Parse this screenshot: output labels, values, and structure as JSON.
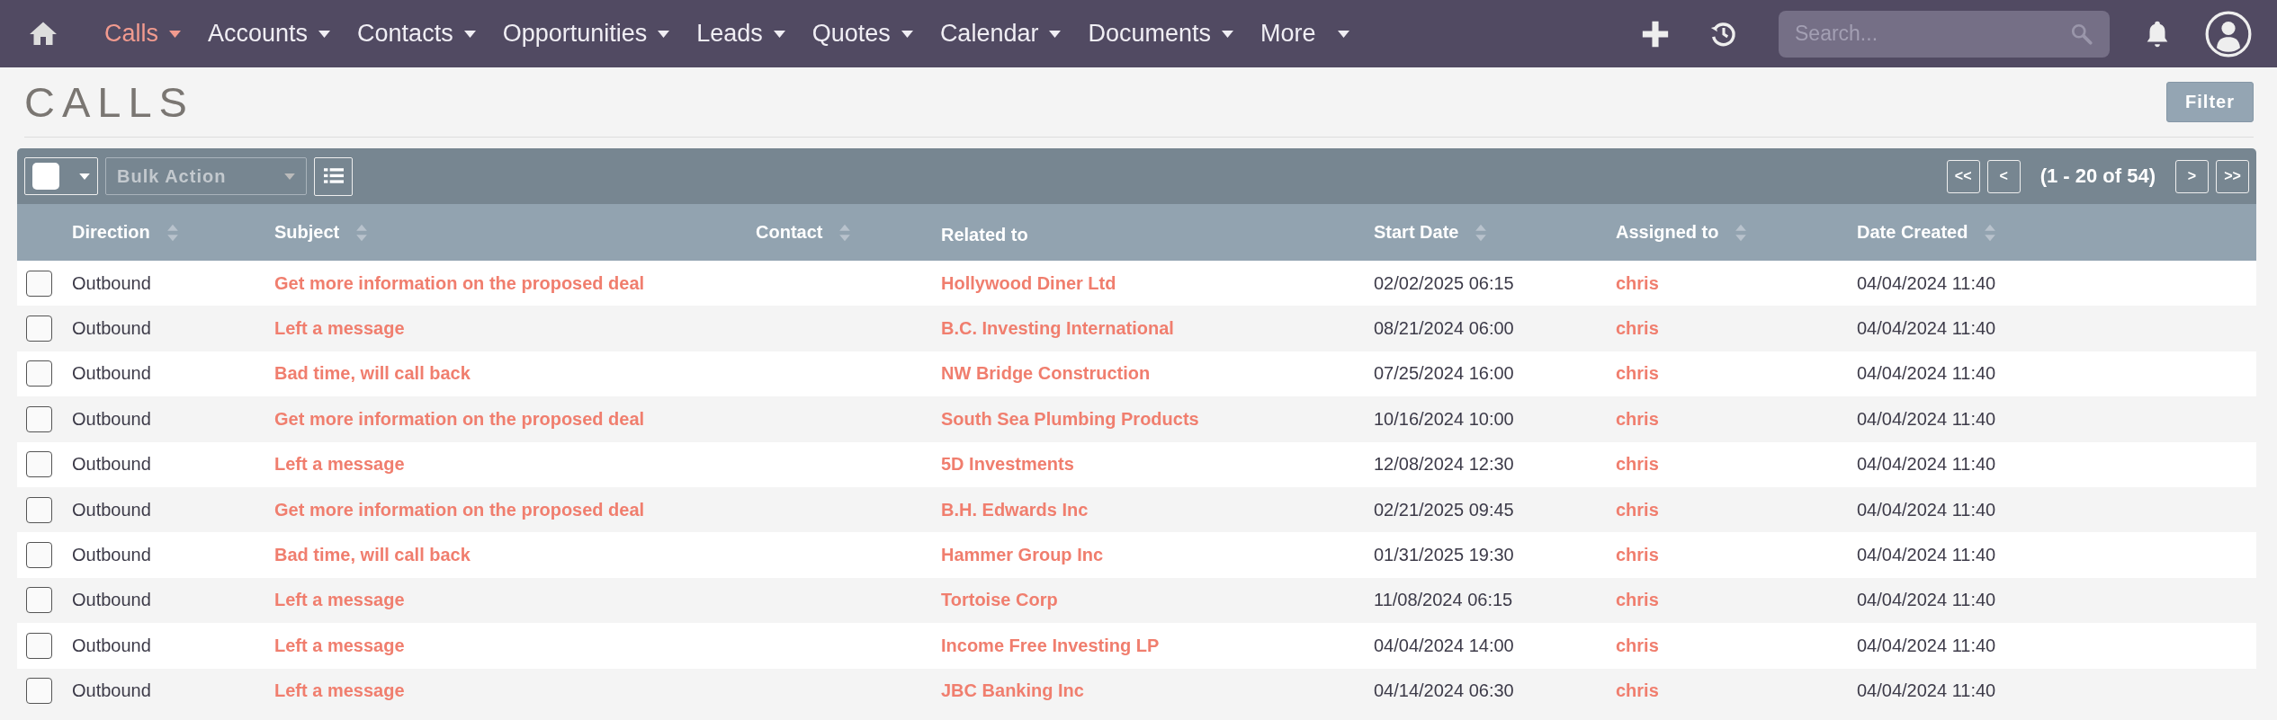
{
  "nav": {
    "items": [
      {
        "label": "Calls",
        "selected": true
      },
      {
        "label": "Accounts",
        "selected": false
      },
      {
        "label": "Contacts",
        "selected": false
      },
      {
        "label": "Opportunities",
        "selected": false
      },
      {
        "label": "Leads",
        "selected": false
      },
      {
        "label": "Quotes",
        "selected": false
      },
      {
        "label": "Calendar",
        "selected": false
      },
      {
        "label": "Documents",
        "selected": false
      },
      {
        "label": "More",
        "selected": false
      }
    ],
    "search": {
      "placeholder": "Search..."
    }
  },
  "page_title": "CALLS",
  "filter_button": "Filter",
  "toolbar": {
    "bulk_action": "Bulk Action",
    "pagination": {
      "first": "<<",
      "prev": "<",
      "range": "(1 - 20 of 54)",
      "next": ">",
      "last": ">>"
    }
  },
  "table": {
    "columns": [
      {
        "label": "Direction",
        "sortable": true
      },
      {
        "label": "Subject",
        "sortable": true
      },
      {
        "label": "Contact",
        "sortable": true
      },
      {
        "label": "Related to",
        "sortable": false
      },
      {
        "label": "Start Date",
        "sortable": true
      },
      {
        "label": "Assigned to",
        "sortable": true
      },
      {
        "label": "Date Created",
        "sortable": true
      }
    ],
    "rows": [
      {
        "checked": false,
        "direction": "Outbound",
        "subject": "Get more information on the proposed deal",
        "related_to": "Hollywood Diner Ltd",
        "start_date": "02/02/2025 06:15",
        "assigned_to": "chris",
        "date_created": "04/04/2024 11:40"
      },
      {
        "checked": false,
        "direction": "Outbound",
        "subject": "Left a message",
        "related_to": "B.C. Investing International",
        "start_date": "08/21/2024 06:00",
        "assigned_to": "chris",
        "date_created": "04/04/2024 11:40"
      },
      {
        "checked": false,
        "direction": "Outbound",
        "subject": "Bad time, will call back",
        "related_to": "NW Bridge Construction",
        "start_date": "07/25/2024 16:00",
        "assigned_to": "chris",
        "date_created": "04/04/2024 11:40"
      },
      {
        "checked": false,
        "direction": "Outbound",
        "subject": "Get more information on the proposed deal",
        "related_to": "South Sea Plumbing Products",
        "start_date": "10/16/2024 10:00",
        "assigned_to": "chris",
        "date_created": "04/04/2024 11:40"
      },
      {
        "checked": false,
        "direction": "Outbound",
        "subject": "Left a message",
        "related_to": "5D Investments",
        "start_date": "12/08/2024 12:30",
        "assigned_to": "chris",
        "date_created": "04/04/2024 11:40"
      },
      {
        "checked": false,
        "direction": "Outbound",
        "subject": "Get more information on the proposed deal",
        "related_to": "B.H. Edwards Inc",
        "start_date": "02/21/2025 09:45",
        "assigned_to": "chris",
        "date_created": "04/04/2024 11:40"
      },
      {
        "checked": false,
        "direction": "Outbound",
        "subject": "Bad time, will call back",
        "related_to": "Hammer Group Inc",
        "start_date": "01/31/2025 19:30",
        "assigned_to": "chris",
        "date_created": "04/04/2024 11:40"
      },
      {
        "checked": false,
        "direction": "Outbound",
        "subject": "Left a message",
        "related_to": "Tortoise Corp",
        "start_date": "11/08/2024 06:15",
        "assigned_to": "chris",
        "date_created": "04/04/2024 11:40"
      },
      {
        "checked": false,
        "direction": "Outbound",
        "subject": "Left a message",
        "related_to": "Income Free Investing LP",
        "start_date": "04/04/2024 14:00",
        "assigned_to": "chris",
        "date_created": "04/04/2024 11:40"
      },
      {
        "checked": false,
        "direction": "Outbound",
        "subject": "Left a message",
        "related_to": "JBC Banking Inc",
        "start_date": "04/14/2024 06:30",
        "assigned_to": "chris",
        "date_created": "04/04/2024 11:40"
      }
    ]
  }
}
